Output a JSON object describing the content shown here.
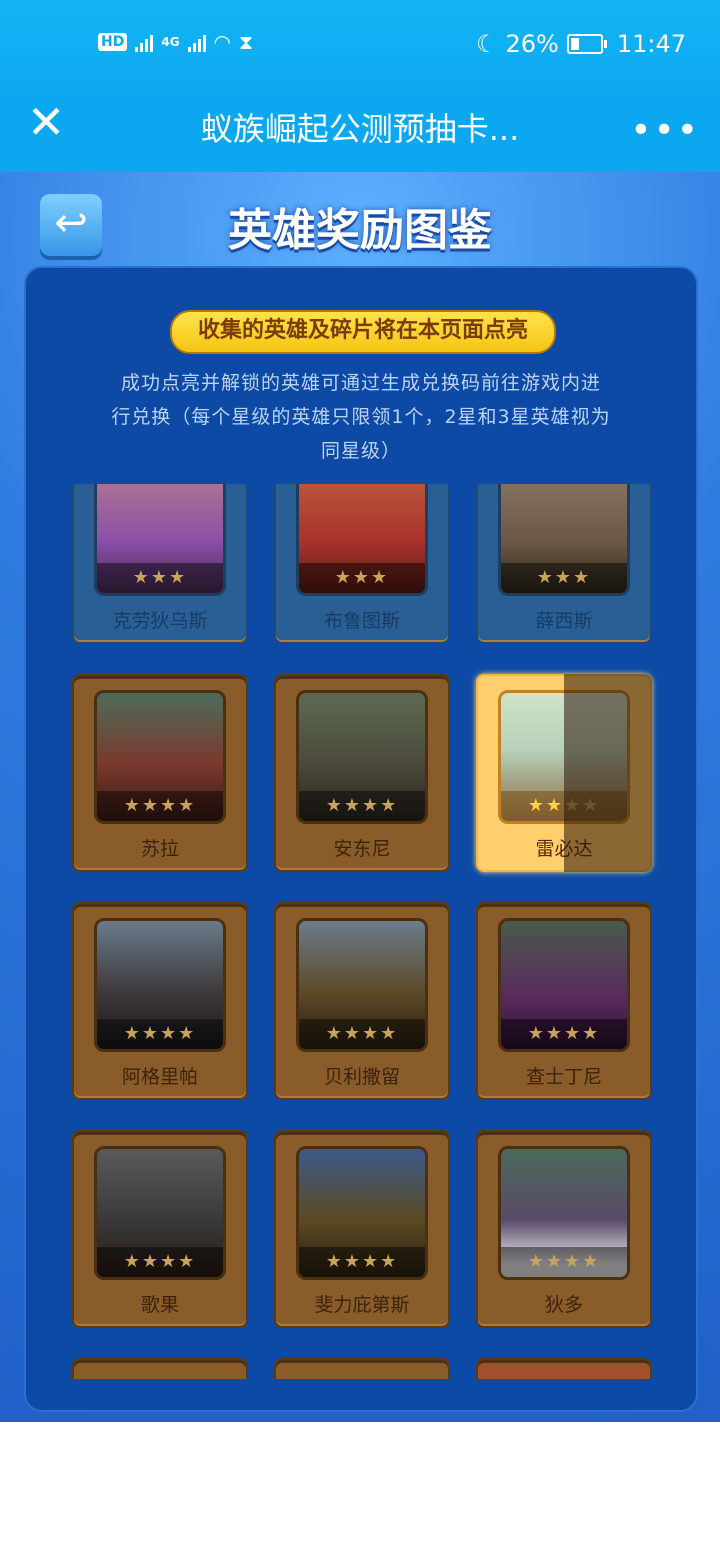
{
  "status": {
    "battery": "26%",
    "time": "11:47",
    "network": "4G",
    "hd": "HD"
  },
  "nav": {
    "title": "蚁族崛起公测预抽卡...",
    "close_glyph": "✕",
    "more_glyph": "•••"
  },
  "game": {
    "title": "英雄奖励图鉴",
    "back_glyph": "↩",
    "banner": "收集的英雄及碎片将在本页面点亮",
    "desc_line1": "成功点亮并解锁的英雄可通过生成兑换码前往游戏内进",
    "desc_line2": "行兑换（每个星级的英雄只限领1个，2星和3星英雄视为",
    "desc_line3": "同星级）",
    "heroes": [
      {
        "name": "克劳狄乌斯",
        "stars": "★★★",
        "state": "dim",
        "color": "#8a4fa8"
      },
      {
        "name": "布鲁图斯",
        "stars": "★★★",
        "state": "dim",
        "color": "#a8332b"
      },
      {
        "name": "薛西斯",
        "stars": "★★★",
        "state": "dim",
        "color": "#6b5844"
      },
      {
        "name": "苏拉",
        "stars": "★★★★",
        "state": "locked",
        "color": "#7a3a2e"
      },
      {
        "name": "安东尼",
        "stars": "★★★★",
        "state": "locked",
        "color": "#4b4a3a"
      },
      {
        "name": "雷必达",
        "stars": "★★★★",
        "lit_stars": "★★",
        "unlit_stars": "★★",
        "state": "active",
        "color": "#b7d0b8"
      },
      {
        "name": "阿格里帕",
        "stars": "★★★★",
        "state": "locked",
        "color": "#3e3a3c"
      },
      {
        "name": "贝利撒留",
        "stars": "★★★★",
        "state": "locked",
        "color": "#5c4a2a"
      },
      {
        "name": "查士丁尼",
        "stars": "★★★★",
        "state": "locked",
        "color": "#5a2a5e"
      },
      {
        "name": "歌果",
        "stars": "★★★★",
        "state": "locked",
        "color": "#3a3a3a"
      },
      {
        "name": "斐力庇第斯",
        "stars": "★★★★",
        "state": "locked",
        "color": "#5a4a24"
      },
      {
        "name": "狄多",
        "stars": "★★★★",
        "state": "locked",
        "color": "#5a4a6a"
      }
    ]
  }
}
